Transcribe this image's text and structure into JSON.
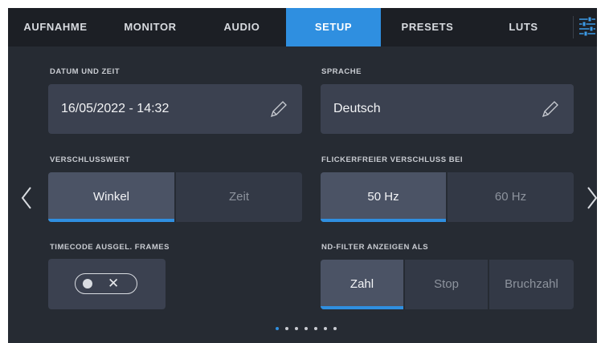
{
  "tabs": [
    {
      "label": "AUFNAHME"
    },
    {
      "label": "MONITOR"
    },
    {
      "label": "AUDIO"
    },
    {
      "label": "SETUP"
    },
    {
      "label": "PRESETS"
    },
    {
      "label": "LUTS"
    }
  ],
  "active_tab": "SETUP",
  "date_time": {
    "label": "DATUM UND ZEIT",
    "value": "16/05/2022 - 14:32"
  },
  "language": {
    "label": "SPRACHE",
    "value": "Deutsch"
  },
  "shutter_value": {
    "label": "VERSCHLUSSWERT",
    "options": [
      "Winkel",
      "Zeit"
    ],
    "selected": "Winkel"
  },
  "flicker_free": {
    "label": "FLICKERFREIER VERSCHLUSS BEI",
    "options": [
      "50 Hz",
      "60 Hz"
    ],
    "selected": "50 Hz"
  },
  "timecode_dropframe": {
    "label": "TIMECODE AUSGEL. FRAMES",
    "state_symbol": "✕"
  },
  "nd_filter": {
    "label": "ND-FILTER ANZEIGEN ALS",
    "options": [
      "Zahl",
      "Stop",
      "Bruchzahl"
    ],
    "selected": "Zahl"
  },
  "pagination": {
    "pages": 7,
    "current": 1
  },
  "colors": {
    "accent": "#2f8fe0",
    "background": "#262b33",
    "tab_bar": "#1c1f25",
    "panel": "#3b4150"
  },
  "icons": [
    "settings-sliders-icon",
    "pencil-icon",
    "chevron-left-icon",
    "chevron-right-icon",
    "toggle-switch-icon",
    "close-x-icon"
  ]
}
